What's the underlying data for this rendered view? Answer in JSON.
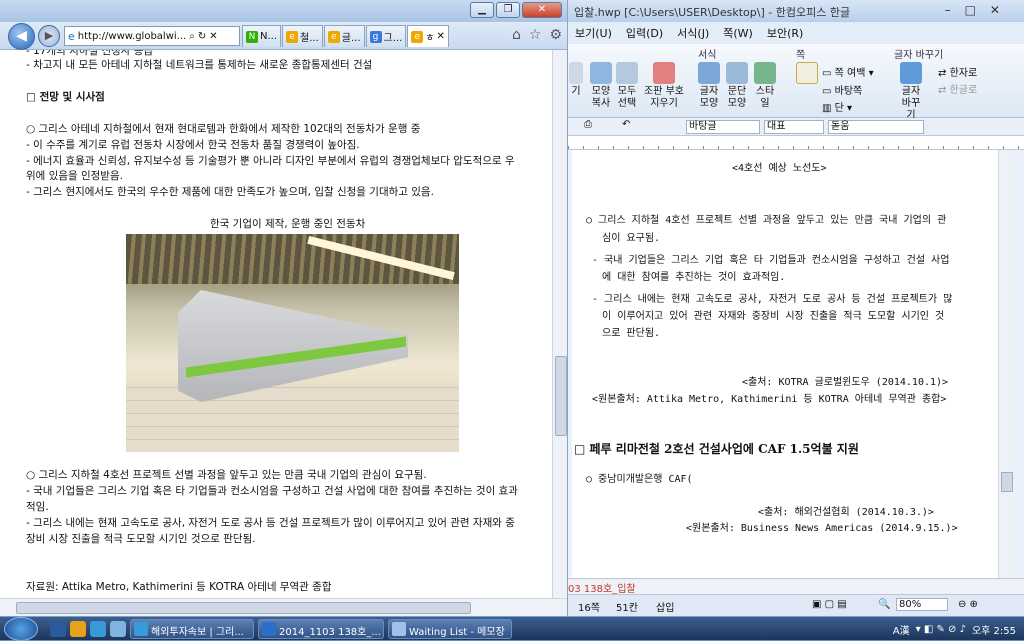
{
  "ie": {
    "address": "http://www.globalwi...",
    "tabs": [
      {
        "label": "N...",
        "icon": "naver-icon",
        "color": "#2db400"
      },
      {
        "label": "철...",
        "icon": "ie-page-icon",
        "color": "#f0a800"
      },
      {
        "label": "글...",
        "icon": "ie-page-icon",
        "color": "#f0a800"
      },
      {
        "label": "그...",
        "icon": "google-icon",
        "color": "#3c78d8"
      },
      {
        "label": "ㅎ",
        "icon": "ie-page-icon",
        "color": "#f0a800"
      }
    ],
    "content": {
      "line0": "- 17개의 지하철 신청사 증급",
      "line1": "- 차고지 내 모든 아테네 지하철 네트워크를 통제하는 새로운 종합통제센터 건설",
      "section": "□ 전망 및 시사점",
      "p1": "○ 그리스 아테네 지하철에서 현재 현대로템과 한화에서 제작한 102대의 전동차가 운행 중",
      "p2": "- 이 수주를 계기로 유럽 전동차 시장에서 한국 전동차 품질 경쟁력이 높아짐.",
      "p3": "- 에너지 효율과 신뢰성, 유지보수성 등 기술평가 뿐 아니라 디자인 부분에서 유럽의 경쟁업체보다 압도적으로 우",
      "p3b": "  위에 있음을 인정받음.",
      "p4": "- 그리스 현지에서도 한국의 우수한 제품에 대한 만족도가 높으며, 입찰 신청을 기대하고 있음.",
      "caption": "한국 기업이 제작, 운행 중인 전동차",
      "q1": "○ 그리스 지하철 4호선 프로젝트 선별 과정을 앞두고 있는 만큼 국내 기업의 관심이 요구됨.",
      "q2": "- 국내 기업들은 그리스 기업 혹은 타 기업들과 컨소시엄을 구성하고 건설 사업에 대한 참여를 추진하는 것이 효과",
      "q2b": "  적임.",
      "q3": "- 그리스 내에는 현재 고속도로 공사, 자전거 도로 공사 등 건설 프로젝트가 많이 이루어지고 있어 관련 자재와 중",
      "q3b": "  장비 시장 진출을 적극 도모할 시기인 것으로 판단됨.",
      "source": "자료원: Attika Metro, Kathimerini 등 KOTRA 아테네 무역관 종합"
    }
  },
  "hwp": {
    "title": "입찰.hwp [C:\\Users\\USER\\Desktop\\] - 한컴오피스 한글",
    "menus": [
      "보기(U)",
      "입력(D)",
      "서식(J)",
      "쪽(W)",
      "보안(R)"
    ],
    "ribbon": {
      "group_format": "서식",
      "group_page": "쪽",
      "group_convert": "글자 바꾸기",
      "btn_copy_shape": "모양 복사",
      "btn_select_all": "모두 선택",
      "btn_symbol": "조판 부호 지우기",
      "btn_char_shape": "글자 모양",
      "btn_para_shape": "문단 모양",
      "btn_style": "스타일",
      "btn_page_margin": "쪽 여백",
      "btn_bg": "바탕쪽",
      "btn_col": "단",
      "btn_char_convert": "글자 바꾸기",
      "btn_hanja": "한자로",
      "btn_hangul": "한글로",
      "left_cut": "기"
    },
    "formatbar": {
      "style": "바탕글",
      "rep": "대표",
      "font": "돋움"
    },
    "doc": {
      "caption": "<4호선 예상 노선도>",
      "b1a": "○ 그리스 지하철 4호선 프로젝트 선별 과정을 앞두고 있는 만큼 국내 기업의 관",
      "b1b": "심이 요구됨.",
      "b2a": "- 국내 기업들은 그리스 기업 혹은 타 기업들과 컨소시엄을 구성하고 건설 사업",
      "b2b": "에 대한 참여를 추진하는 것이 효과적임.",
      "b3a": "- 그리스 내에는 현재 고속도로 공사, 자전거 도로 공사 등 건설 프로젝트가 많",
      "b3b": "이 이루어지고 있어 관련 자재와 중장비 시장 진출을 적극 도모할 시기인 것",
      "b3c": "으로 판단됨.",
      "src1": "<출처: KOTRA 글로벌윈도우 (2014.10.1)>",
      "src2": "<원본출처: Attika Metro, Kathimerini 등 KOTRA 아테네 무역관 종합>",
      "heading": "□ 페루 리마전철 2호선 건설사업에 CAF 1.5억불 지원",
      "c1": "○ 중남미개발은행 CAF(",
      "src3": "<출처: 해외건설협회 (2014.10.3.)>",
      "src4": "<원본출처: Business News Americas (2014.9.15.)>"
    },
    "tabbar": "03 138호_입찰",
    "status": {
      "page": "16쪽",
      "col": "51칸",
      "mode": "삽입",
      "zoom": "80%"
    }
  },
  "taskbar": {
    "tasks": [
      "해외투자속보 | 그리...",
      "2014_1103 138호_...",
      "Waiting List - 메모장"
    ],
    "ime": "A漢",
    "time": "오후 2:55"
  }
}
